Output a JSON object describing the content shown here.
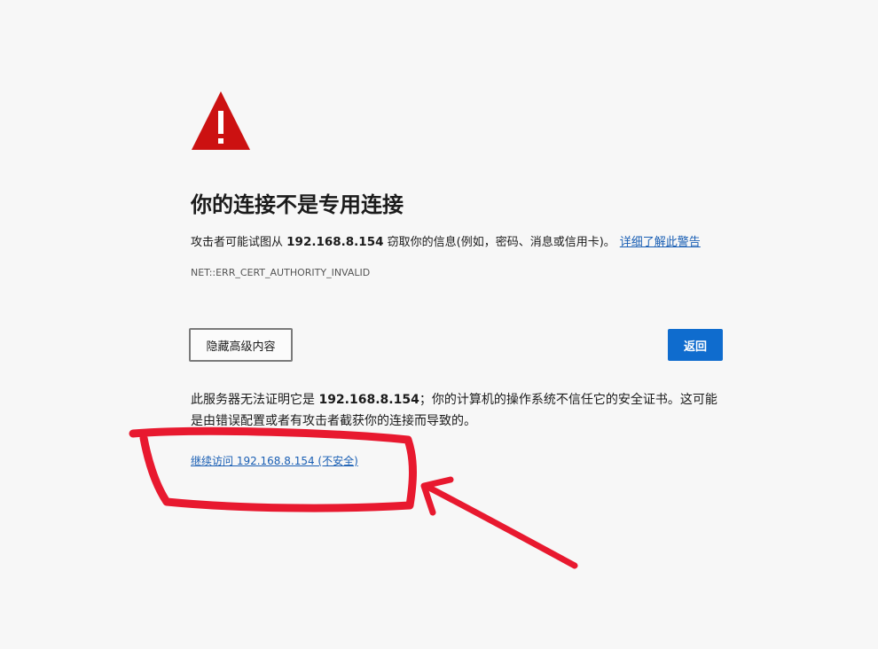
{
  "title": "你的连接不是专用连接",
  "description": {
    "prefix": "攻击者可能试图从",
    "host": "192.168.8.154",
    "suffix": "窃取你的信息(例如，密码、消息或信用卡)。",
    "learn_more_link": "详细了解此警告"
  },
  "error_code": "NET::ERR_CERT_AUTHORITY_INVALID",
  "buttons": {
    "advanced_label": "隐藏高级内容",
    "back_label": "返回"
  },
  "details": {
    "prefix": "此服务器无法证明它是",
    "host": "192.168.8.154",
    "suffix": "；你的计算机的操作系统不信任它的安全证书。这可能是由错误配置或者有攻击者截获你的连接而导致的。"
  },
  "proceed_link": "继续访问 192.168.8.154 (不安全)",
  "colors": {
    "background": "#f7f7f7",
    "warning_red": "#cc1111",
    "link_blue": "#1a5fb4",
    "primary_button": "#0f6cce",
    "annotation_red": "#e8192f"
  },
  "icons": {
    "warning": "warning-triangle-icon"
  }
}
